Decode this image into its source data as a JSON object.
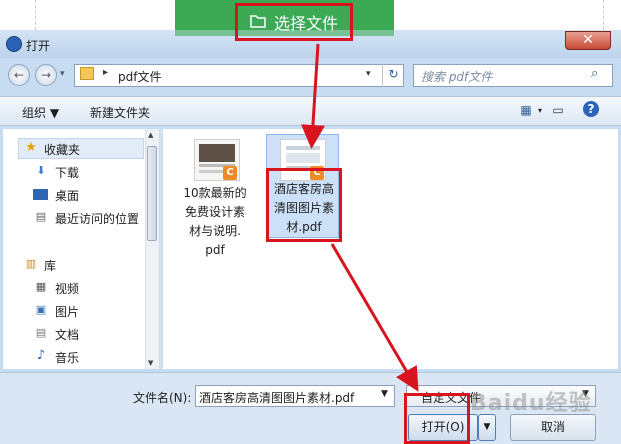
{
  "overlay": {
    "choose_file_label": "选择文件"
  },
  "window": {
    "title": "打开",
    "close_symbol": "✕"
  },
  "address": {
    "path_segment": "pdf文件",
    "back_symbol": "←",
    "forward_symbol": "→",
    "refresh_symbol": "↻",
    "breadcrumb_arrow": "▸",
    "dropdown_symbol": "▾"
  },
  "search": {
    "placeholder": "搜索 pdf文件",
    "icon_symbol": "⌕"
  },
  "toolbar": {
    "organize_label": "组织 ▼",
    "new_folder_label": "新建文件夹",
    "view_symbol": "▦",
    "pane_symbol": "▭",
    "help_symbol": "?"
  },
  "sidebar": {
    "favorites_label": "收藏夹",
    "favorites": [
      "下载",
      "桌面",
      "最近访问的位置"
    ],
    "library_label": "库",
    "libraries": [
      "视频",
      "图片",
      "文档",
      "音乐"
    ]
  },
  "files": [
    {
      "name_lines": [
        "10款最新的",
        "免费设计素",
        "材与说明.",
        "pdf"
      ],
      "badge": "C"
    },
    {
      "name_lines": [
        "酒店客房高",
        "清图图片素",
        "材.pdf"
      ],
      "badge": "C"
    }
  ],
  "bottom": {
    "filename_label": "文件名(N):",
    "filename_value": "酒店客房高清图图片素材.pdf",
    "filetype_value": "自定义文件",
    "open_label": "打开(O)",
    "cancel_label": "取消",
    "dropdown_symbol": "▼"
  },
  "watermark": "Baidu经验",
  "colors": {
    "highlight_red": "#d8141e",
    "accent_green": "#3caa55",
    "selection_blue": "#cce0f7"
  }
}
